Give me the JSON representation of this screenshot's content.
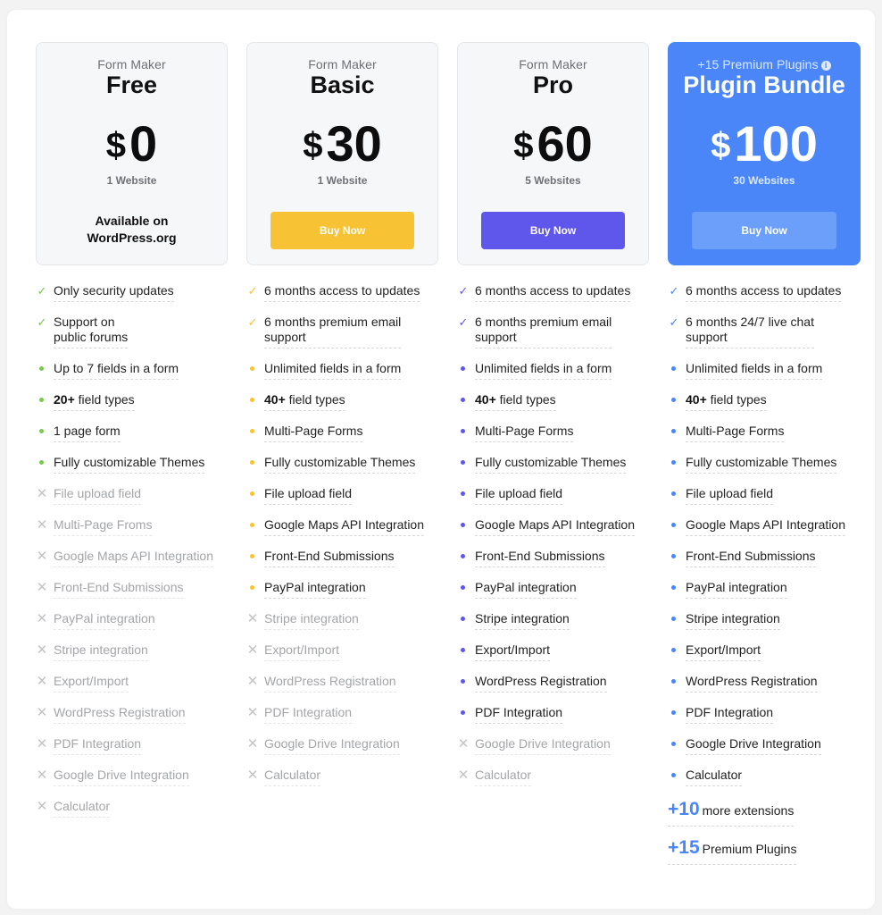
{
  "colors": {
    "free_accent": "#7bc74d",
    "basic_accent": "#f7c233",
    "pro_accent": "#5f56ec",
    "bundle_accent": "#4a86f7",
    "disabled": "#c2c3c6"
  },
  "plans": [
    {
      "subtitle": "Form Maker",
      "name": "Free",
      "currency": "$",
      "price": "0",
      "sites": "1 Website",
      "availability": [
        "Available on",
        "WordPress.org"
      ],
      "features": [
        {
          "icon": "check",
          "text": "Only security updates",
          "included": true
        },
        {
          "icon": "check",
          "text": "Support on\npublic forums",
          "included": true
        },
        {
          "icon": "dot",
          "text": "Up to 7 fields in a form",
          "included": true
        },
        {
          "icon": "dot",
          "bold": "20+",
          "text": " field types",
          "included": true
        },
        {
          "icon": "dot",
          "text": "1 page form",
          "included": true
        },
        {
          "icon": "dot",
          "text": "Fully customizable Themes",
          "included": true
        },
        {
          "icon": "x",
          "text": "File upload field",
          "included": false
        },
        {
          "icon": "x",
          "text": "Multi-Page Froms",
          "included": false
        },
        {
          "icon": "x",
          "text": "Google Maps API Integration",
          "included": false
        },
        {
          "icon": "x",
          "text": "Front-End Submissions",
          "included": false
        },
        {
          "icon": "x",
          "text": "PayPal integration",
          "included": false
        },
        {
          "icon": "x",
          "text": "Stripe integration",
          "included": false
        },
        {
          "icon": "x",
          "text": "Export/Import",
          "included": false
        },
        {
          "icon": "x",
          "text": "WordPress Registration",
          "included": false
        },
        {
          "icon": "x",
          "text": "PDF Integration",
          "included": false
        },
        {
          "icon": "x",
          "text": "Google Drive Integration",
          "included": false
        },
        {
          "icon": "x",
          "text": "Calculator",
          "included": false
        }
      ]
    },
    {
      "subtitle": "Form Maker",
      "name": "Basic",
      "currency": "$",
      "price": "30",
      "sites": "1 Website",
      "button": "Buy Now",
      "features": [
        {
          "icon": "check",
          "text": "6 months access to updates",
          "included": true
        },
        {
          "icon": "check",
          "text": "6 months premium email\nsupport",
          "included": true
        },
        {
          "icon": "dot",
          "text": "Unlimited fields in a form",
          "included": true
        },
        {
          "icon": "dot",
          "bold": "40+",
          "text": " field types",
          "included": true
        },
        {
          "icon": "dot",
          "text": "Multi-Page Forms",
          "included": true
        },
        {
          "icon": "dot",
          "text": "Fully customizable Themes",
          "included": true
        },
        {
          "icon": "dot",
          "text": "File upload field",
          "included": true
        },
        {
          "icon": "dot",
          "text": "Google Maps API Integration",
          "included": true
        },
        {
          "icon": "dot",
          "text": "Front-End Submissions",
          "included": true
        },
        {
          "icon": "dot",
          "text": "PayPal integration",
          "included": true
        },
        {
          "icon": "x",
          "text": "Stripe integration",
          "included": false
        },
        {
          "icon": "x",
          "text": "Export/Import",
          "included": false
        },
        {
          "icon": "x",
          "text": "WordPress Registration",
          "included": false
        },
        {
          "icon": "x",
          "text": "PDF Integration",
          "included": false
        },
        {
          "icon": "x",
          "text": "Google Drive Integration",
          "included": false
        },
        {
          "icon": "x",
          "text": "Calculator",
          "included": false
        }
      ]
    },
    {
      "subtitle": "Form Maker",
      "name": "Pro",
      "currency": "$",
      "price": "60",
      "sites": "5 Websites",
      "button": "Buy Now",
      "features": [
        {
          "icon": "check",
          "text": "6 months access to updates",
          "included": true
        },
        {
          "icon": "check",
          "text": "6 months premium email\nsupport",
          "included": true
        },
        {
          "icon": "dot",
          "text": "Unlimited fields in a form",
          "included": true
        },
        {
          "icon": "dot",
          "bold": "40+",
          "text": " field types",
          "included": true
        },
        {
          "icon": "dot",
          "text": "Multi-Page Forms",
          "included": true
        },
        {
          "icon": "dot",
          "text": "Fully customizable Themes",
          "included": true
        },
        {
          "icon": "dot",
          "text": "File upload field",
          "included": true
        },
        {
          "icon": "dot",
          "text": "Google Maps API Integration",
          "included": true
        },
        {
          "icon": "dot",
          "text": "Front-End Submissions",
          "included": true
        },
        {
          "icon": "dot",
          "text": "PayPal integration",
          "included": true
        },
        {
          "icon": "dot",
          "text": "Stripe integration",
          "included": true
        },
        {
          "icon": "dot",
          "text": "Export/Import",
          "included": true
        },
        {
          "icon": "dot",
          "text": "WordPress Registration",
          "included": true
        },
        {
          "icon": "dot",
          "text": "PDF Integration",
          "included": true
        },
        {
          "icon": "x",
          "text": "Google Drive Integration",
          "included": false
        },
        {
          "icon": "x",
          "text": "Calculator",
          "included": false
        }
      ]
    },
    {
      "subtitle": "+15 Premium Plugins",
      "subtitle_icon": "info-icon",
      "name": "Plugin Bundle",
      "currency": "$",
      "price": "100",
      "sites": "30 Websites",
      "button": "Buy Now",
      "features": [
        {
          "icon": "check",
          "text": "6 months access to updates",
          "included": true
        },
        {
          "icon": "check",
          "text": "6 months 24/7 live chat\nsupport",
          "included": true
        },
        {
          "icon": "dot",
          "text": "Unlimited fields in a form",
          "included": true
        },
        {
          "icon": "dot",
          "bold": "40+",
          "text": " field types",
          "included": true
        },
        {
          "icon": "dot",
          "text": "Multi-Page Forms",
          "included": true
        },
        {
          "icon": "dot",
          "text": "Fully customizable Themes",
          "included": true
        },
        {
          "icon": "dot",
          "text": "File upload field",
          "included": true
        },
        {
          "icon": "dot",
          "text": "Google Maps API Integration",
          "included": true
        },
        {
          "icon": "dot",
          "text": "Front-End Submissions",
          "included": true
        },
        {
          "icon": "dot",
          "text": "PayPal integration",
          "included": true
        },
        {
          "icon": "dot",
          "text": "Stripe integration",
          "included": true
        },
        {
          "icon": "dot",
          "text": "Export/Import",
          "included": true
        },
        {
          "icon": "dot",
          "text": "WordPress Registration",
          "included": true
        },
        {
          "icon": "dot",
          "text": "PDF Integration",
          "included": true
        },
        {
          "icon": "dot",
          "text": "Google Drive Integration",
          "included": true
        },
        {
          "icon": "dot",
          "text": "Calculator",
          "included": true
        }
      ],
      "extras": [
        {
          "number": "+10",
          "text": "more extensions"
        },
        {
          "number": "+15",
          "text": "Premium Plugins"
        }
      ]
    }
  ]
}
